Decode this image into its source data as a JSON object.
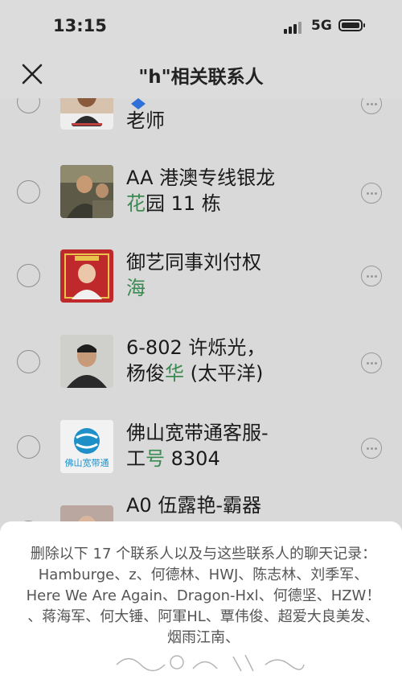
{
  "status_bar": {
    "time": "13:15",
    "network": "5G"
  },
  "header": {
    "title": "\"h\"相关联系人"
  },
  "contacts": [
    {
      "line1": "",
      "line2_plain": "老师",
      "line2_hl": "",
      "line2_rest": ""
    },
    {
      "line1": "AA 港澳专线银龙",
      "line2_plain": "",
      "line2_hl": "花",
      "line2_rest": "园 11 栋"
    },
    {
      "line1": "御艺同事刘付权",
      "line2_plain": "",
      "line2_hl": "海",
      "line2_rest": ""
    },
    {
      "line1": "6-802 许烁光，",
      "line2_plain": "杨俊",
      "line2_hl": "华",
      "line2_rest": " (太平洋)"
    },
    {
      "line1": "佛山宽带通客服-",
      "line2_plain": "工",
      "line2_hl": "号",
      "line2_rest": " 8304"
    },
    {
      "line1": "A0 伍露艳-霸器",
      "line2_plain": "",
      "line2_hl": "",
      "line2_rest": ""
    }
  ],
  "avatar_texts": {
    "broadband_logo": "佛山宽带通"
  },
  "sheet": {
    "message": "删除以下 17 个联系人以及与这些联系人的聊天记录：Hamburge、z、何德林、HWJ、陈志林、刘季军、Here We Are Again、Dragon-Hxl、何德坚、HZW！ 、蒋海军、何大锤、阿軍HL、覃伟俊、超爱大良美发、烟雨江南、"
  },
  "colors": {
    "highlight": "#3a8a52",
    "overlay": "#d9d9d9",
    "sheet": "#ffffff"
  }
}
